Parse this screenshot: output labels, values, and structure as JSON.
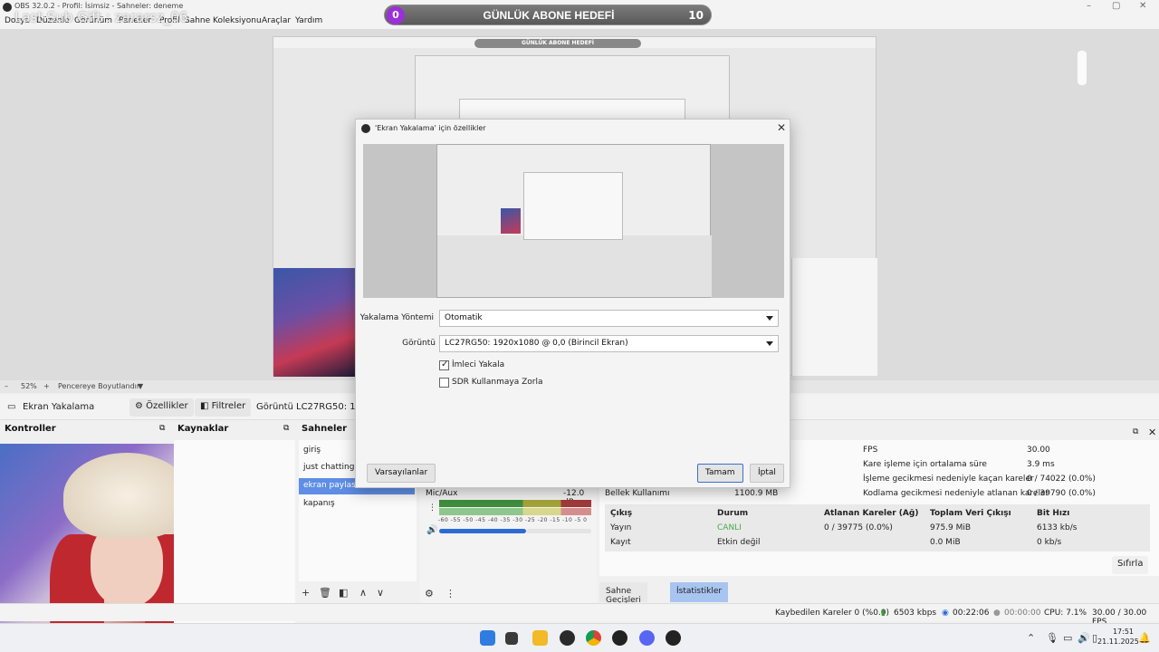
{
  "window": {
    "title": "OBS 32.0.2 - Profil: İsimsiz - Sahneler: deneme",
    "overlay_text": "Last Sub Gift : zararsz_06",
    "controls": [
      "–",
      "▢",
      "✕"
    ]
  },
  "menu": [
    "Dosya",
    "Düzenle",
    "Görünüm",
    "Paneller",
    "Profil",
    "Sahne Koleksiyonu",
    "Araçlar",
    "Yardım"
  ],
  "goal": {
    "current": "0",
    "label": "GÜNLÜK ABONE HEDEFİ",
    "target": "10"
  },
  "preview": {
    "inner_goal_label": "GÜNLÜK ABONE HEDEFİ"
  },
  "zoombar": {
    "zoom": "52%",
    "mode": "Pencereye Boyutlandır"
  },
  "source_toolbar": {
    "source_name": "Ekran Yakalama",
    "properties": "Özellikler",
    "filters": "Filtreler",
    "display_label": "Görüntü",
    "display_value": "LC27RG50: 1920x"
  },
  "docks": {
    "controls": "Kontroller",
    "sources": "Kaynaklar",
    "scenes": "Sahneler"
  },
  "scenes": [
    "giriş",
    "just chatting",
    "ekran paylasımı",
    "kapanış"
  ],
  "mixer": {
    "name": "Mic/Aux",
    "level": "-12.0 dB",
    "scale": "-60 -55 -50 -45 -40 -35 -30 -25 -20 -15 -10 -5 0",
    "volume": 0.57
  },
  "stats": {
    "memory_label": "Bellek Kullanımı",
    "memory_value": "1100.9 MB",
    "rows": [
      {
        "label": "FPS",
        "value": "30.00"
      },
      {
        "label": "Kare işleme için ortalama süre",
        "value": "3.9 ms"
      },
      {
        "label": "İşleme gecikmesi nedeniyle kaçan kareler",
        "value": "0 / 74022 (0.0%)"
      },
      {
        "label": "Kodlama gecikmesi nedeniyle atlanan kareler",
        "value": "0 / 39790 (0.0%)"
      }
    ],
    "table_headers": [
      "Çıkış",
      "Durum",
      "Atlanan Kareler (Ağ)",
      "Toplam Veri Çıkışı",
      "Bit Hızı"
    ],
    "table_rows": [
      [
        "Yayın",
        "CANLI",
        "0 / 39775 (0.0%)",
        "975.9 MiB",
        "6133 kb/s"
      ],
      [
        "Kayıt",
        "Etkin değil",
        "",
        "0.0 MiB",
        "0 kb/s"
      ]
    ],
    "reset": "Sıfırla",
    "live_color": "#4aa84a"
  },
  "bottom_tabs": [
    "Sahne Geçişleri",
    "İstatistikler"
  ],
  "statusbar": {
    "dropped": "Kaybedilen Kareler 0 (%0.0)",
    "kbps": "6503 kbps",
    "live_time": "00:22:06",
    "rec_time": "00:00:00",
    "cpu": "CPU: 7.1%",
    "fps": "30.00 / 30.00 FPS"
  },
  "taskbar": {
    "time": "17:51",
    "date": "21.11.2025",
    "tray_up": "⌃"
  },
  "dialog": {
    "title": "'Ekran Yakalama' için özellikler",
    "method_label": "Yakalama Yöntemi",
    "method_value": "Otomatik",
    "display_label": "Görüntü",
    "display_value": "LC27RG50: 1920x1080 @ 0,0 (Birincil Ekran)",
    "cursor_label": "İmleci Yakala",
    "sdr_label": "SDR Kullanmaya Zorla",
    "defaults": "Varsayılanlar",
    "ok": "Tamam",
    "cancel": "İptal"
  }
}
